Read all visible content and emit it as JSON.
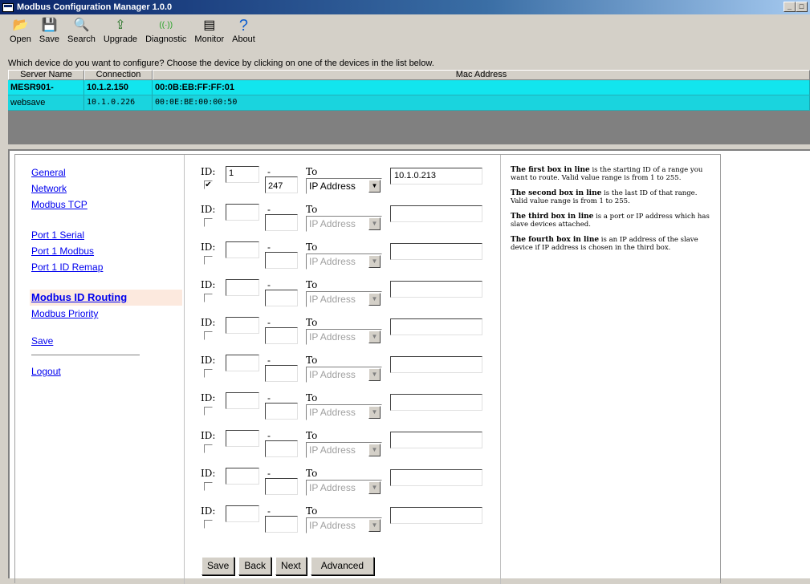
{
  "window": {
    "title": "Modbus Configuration Manager 1.0.0",
    "min_label": "_",
    "max_label": "□"
  },
  "toolbar": {
    "items": [
      {
        "icon": "open-folder-icon",
        "glyph": "📂",
        "label": "Open"
      },
      {
        "icon": "save-disk-icon",
        "glyph": "💾",
        "label": "Save"
      },
      {
        "icon": "search-magnifier-icon",
        "glyph": "🔍",
        "label": "Search"
      },
      {
        "icon": "upgrade-icon",
        "glyph": "⇪",
        "label": "Upgrade"
      },
      {
        "icon": "diagnostic-antenna-icon",
        "glyph": "((·))",
        "label": "Diagnostic"
      },
      {
        "icon": "monitor-icon",
        "glyph": "▤",
        "label": "Monitor"
      },
      {
        "icon": "help-question-icon",
        "glyph": "?",
        "label": "About"
      }
    ]
  },
  "prompt": "Which device do you want to configure? Choose the device by clicking on one of the devices in the list below.",
  "device_list": {
    "headers": [
      "Server Name",
      "Connection",
      "Mac Address"
    ],
    "rows": [
      {
        "name": "MESR901-",
        "connection": "10.1.2.150",
        "mac": "00:0B:EB:FF:FF:01"
      },
      {
        "name": "websave",
        "connection": "10.1.0.226",
        "mac": "00:0E:BE:00:00:50"
      }
    ]
  },
  "nav": {
    "general": "General",
    "network": "Network",
    "modbus_tcp": "Modbus TCP",
    "port1_serial": "Port 1 Serial",
    "port1_modbus": "Port 1 Modbus",
    "port1_id_remap": "Port 1 ID Remap",
    "modbus_id_routing": "Modbus ID Routing",
    "modbus_priority": "Modbus Priority",
    "save": "Save",
    "logout": "Logout"
  },
  "routes": {
    "id_label": "ID:",
    "dash": "-",
    "to_label": "To",
    "rows": [
      {
        "checked": "✔",
        "from": "1",
        "to": "247",
        "target": "IP Address",
        "ip": "10.1.0.213"
      },
      {
        "checked": "",
        "from": "",
        "to": "",
        "target": "IP Address",
        "ip": ""
      },
      {
        "checked": "",
        "from": "",
        "to": "",
        "target": "IP Address",
        "ip": ""
      },
      {
        "checked": "",
        "from": "",
        "to": "",
        "target": "IP Address",
        "ip": ""
      },
      {
        "checked": "",
        "from": "",
        "to": "",
        "target": "IP Address",
        "ip": ""
      },
      {
        "checked": "",
        "from": "",
        "to": "",
        "target": "IP Address",
        "ip": ""
      },
      {
        "checked": "",
        "from": "",
        "to": "",
        "target": "IP Address",
        "ip": ""
      },
      {
        "checked": "",
        "from": "",
        "to": "",
        "target": "IP Address",
        "ip": ""
      },
      {
        "checked": "",
        "from": "",
        "to": "",
        "target": "IP Address",
        "ip": ""
      },
      {
        "checked": "",
        "from": "",
        "to": "",
        "target": "IP Address",
        "ip": ""
      }
    ]
  },
  "buttons": {
    "save": "Save",
    "back": "Back",
    "next": "Next",
    "advanced": "Advanced"
  },
  "help": [
    {
      "bold": "The first box in line",
      "text": " is the starting ID of a range you want to route. Valid value range is from 1 to 255."
    },
    {
      "bold": "The second box in line",
      "text": " is the last ID of that range. Valid value range is from 1 to 255."
    },
    {
      "bold": "The third box in line",
      "text": " is a port or IP address which has slave devices attached."
    },
    {
      "bold": "The fourth box in line",
      "text": " is an IP address of the slave device if IP address is chosen in the third box."
    }
  ]
}
